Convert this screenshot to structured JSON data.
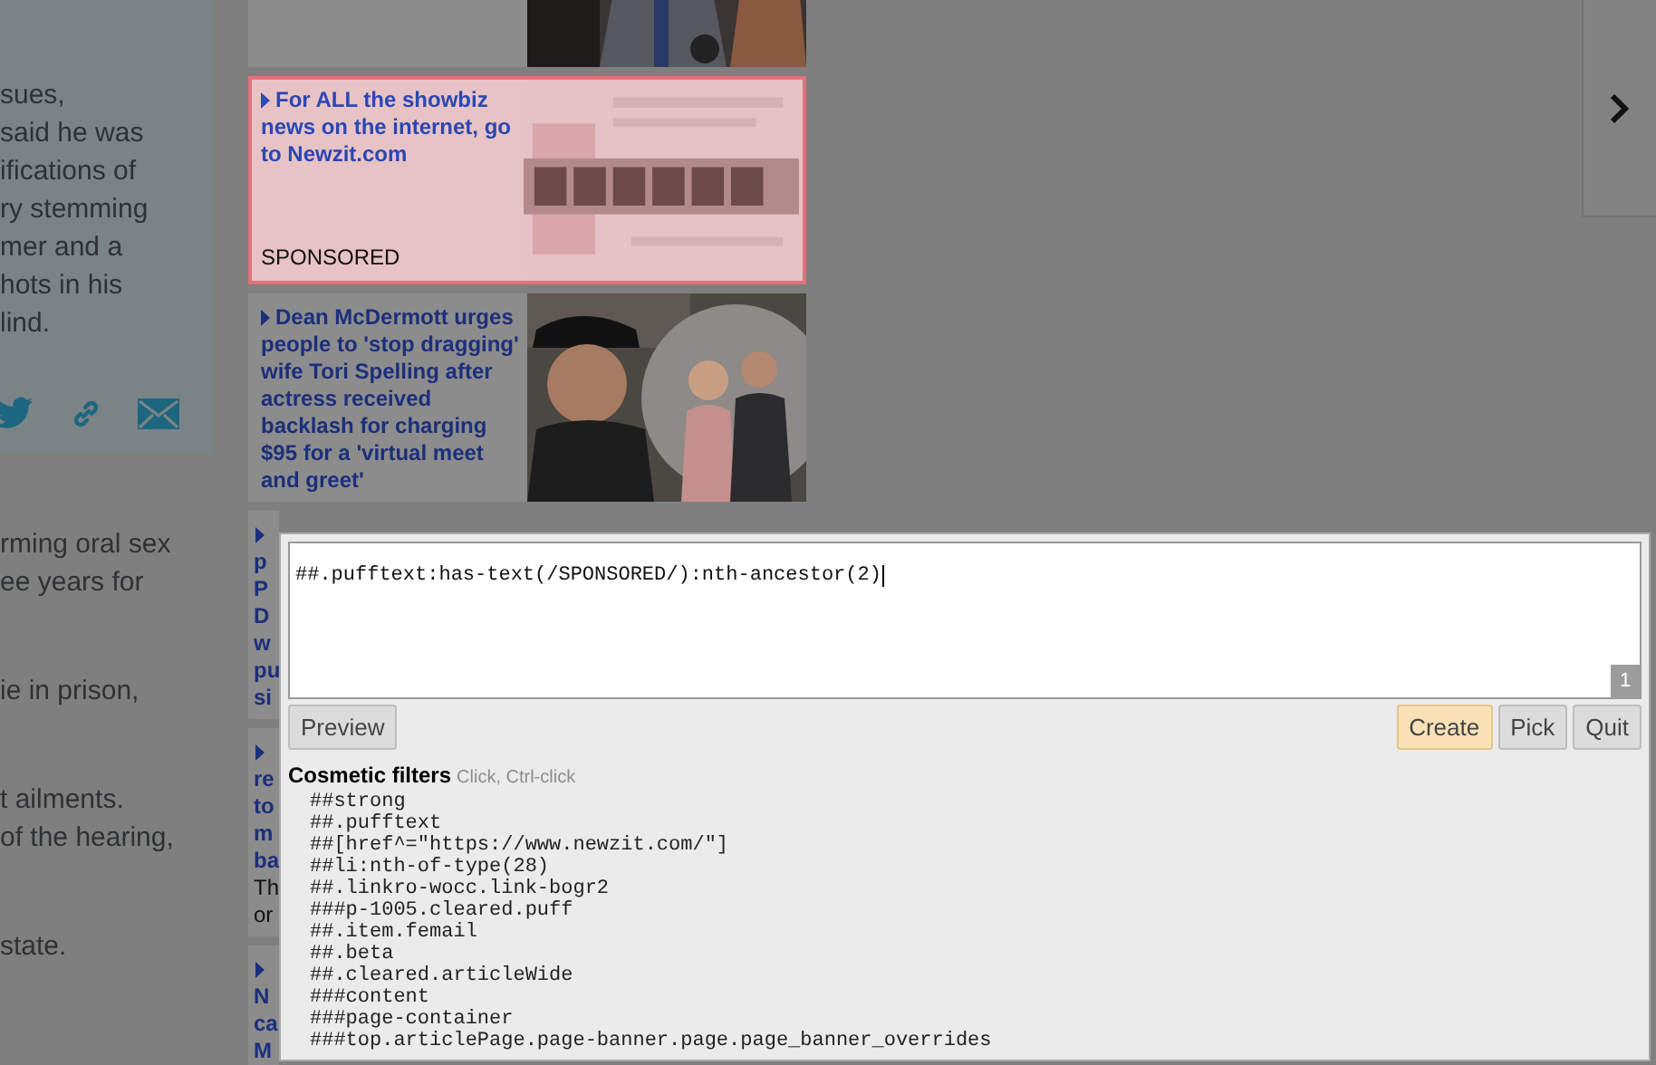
{
  "article": {
    "paragraphs_top": [
      [
        "sues,",
        "said he was",
        "ifications of",
        "ry stemming",
        "mer and a",
        "hots in his",
        "lind."
      ]
    ],
    "paragraphs_bottom": [
      [
        "rming oral sex",
        "ee years for"
      ],
      [
        "ie in prison,"
      ],
      [
        "t ailments.",
        "of the hearing,"
      ],
      [
        "state."
      ]
    ]
  },
  "puffs": [
    {
      "highlighted": false,
      "covered": false
    },
    {
      "headline": [
        "For ALL the showbiz",
        "news on the internet, go",
        "to Newzit.com"
      ],
      "label": "SPONSORED",
      "highlighted": true,
      "covered": false
    },
    {
      "headline": [
        "Dean McDermott urges",
        "people to 'stop dragging'",
        "wife Tori Spelling after",
        "actress received",
        "backlash for charging",
        "$95 for a 'virtual meet",
        "and greet'"
      ],
      "highlighted": false,
      "covered": false
    },
    {
      "headline": [
        "p",
        "P",
        "D",
        "w",
        "pu",
        "si"
      ],
      "highlighted": false,
      "covered": true
    },
    {
      "headline": [
        "re",
        "to",
        "m",
        "ba"
      ],
      "body": [
        "Th",
        "or"
      ],
      "highlighted": false,
      "covered": true
    },
    {
      "headline": [
        "N",
        "ca",
        "M"
      ],
      "highlighted": false,
      "covered": true
    }
  ],
  "picker": {
    "filter": "##.pufftext:has-text(/SPONSORED/):nth-ancestor(2)",
    "count": "1",
    "buttons_left": [
      {
        "label": "Preview",
        "primary": false
      }
    ],
    "buttons_right": [
      {
        "label": "Create",
        "primary": true
      },
      {
        "label": "Pick",
        "primary": false
      },
      {
        "label": "Quit",
        "primary": false
      }
    ],
    "section_title": "Cosmetic filters",
    "section_hint": "Click, Ctrl-click",
    "filters": [
      "##strong",
      "##.pufftext",
      "##[href^=\"https://www.newzit.com/\"]",
      "##li:nth-of-type(28)",
      "##.linkro-wocc.link-bogr2",
      "###p-1005.cleared.puff",
      "##.item.femail",
      "##.beta",
      "##.cleared.articleWide",
      "###content",
      "###page-container",
      "###top.articlePage.page-banner.page.page_banner_overrides"
    ]
  }
}
